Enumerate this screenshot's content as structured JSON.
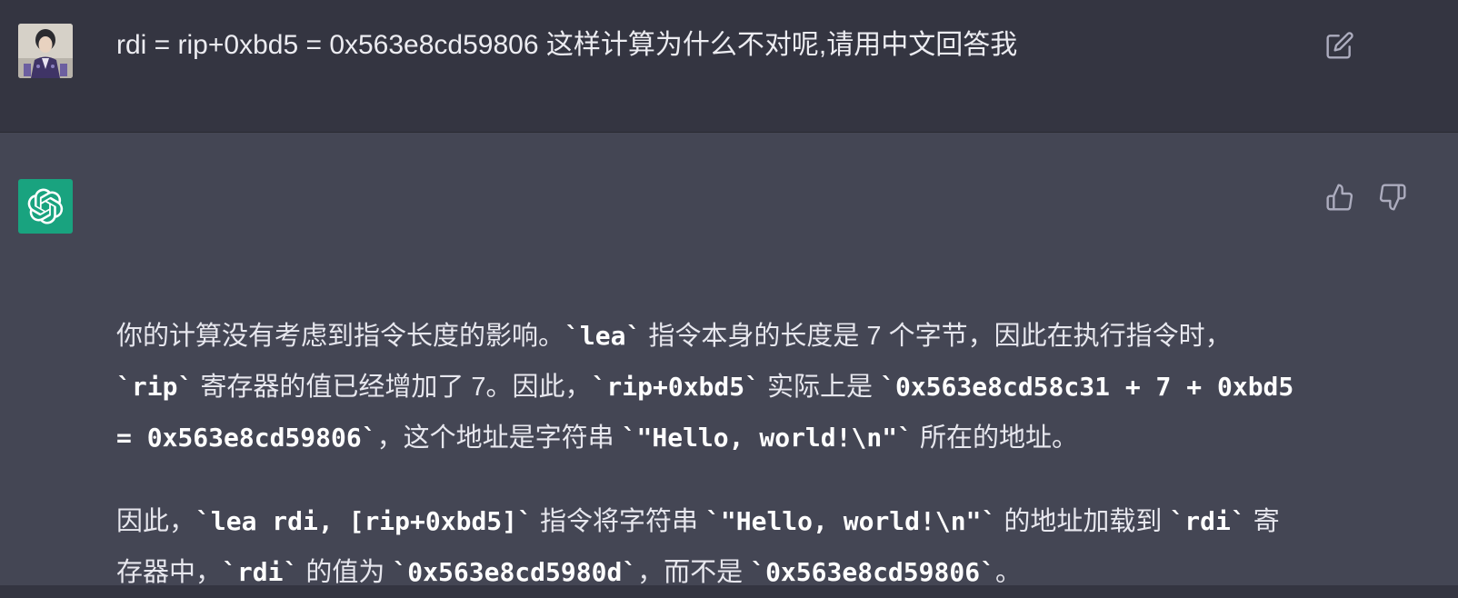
{
  "user_message": {
    "avatar": "user-avatar",
    "text": "rdi = rip+0xbd5 = 0x563e8cd59806 这样计算为什么不对呢,请用中文回答我",
    "edit_icon": "edit-icon"
  },
  "assistant_message": {
    "avatar": "openai-logo-icon",
    "paragraph1": {
      "t1": "你的计算没有考虑到指令长度的影响。",
      "c1": "`lea`",
      "t2": " 指令本身的长度是 7 个字节，因此在执行指令时，",
      "c2": "`rip`",
      "t3": " 寄存器的值已经增加了 7。因此，",
      "c3": "`rip+0xbd5`",
      "t4": " 实际上是 ",
      "c4": "`0x563e8cd58c31 + 7 + 0xbd5 = 0x563e8cd59806`",
      "t5": "，这个地址是字符串 ",
      "c5": "`\"Hello, world!\\n\"`",
      "t6": " 所在的地址。"
    },
    "paragraph2": {
      "t1": "因此，",
      "c1": "`lea rdi, [rip+0xbd5]`",
      "t2": " 指令将字符串 ",
      "c2": "`\"Hello, world!\\n\"`",
      "t3": " 的地址加载到 ",
      "c3": "`rdi`",
      "t4": " 寄存器中，",
      "c4": "`rdi`",
      "t5": " 的值为 ",
      "c5": "`0x563e8cd5980d`",
      "t6": "，而不是 ",
      "c6": "`0x563e8cd59806`",
      "t7": "。"
    },
    "feedback": {
      "up_icon": "thumbs-up-icon",
      "down_icon": "thumbs-down-icon"
    }
  },
  "colors": {
    "user_bg": "#343541",
    "assistant_bg": "#444654",
    "brand": "#19a37f",
    "text": "#ececf1"
  }
}
